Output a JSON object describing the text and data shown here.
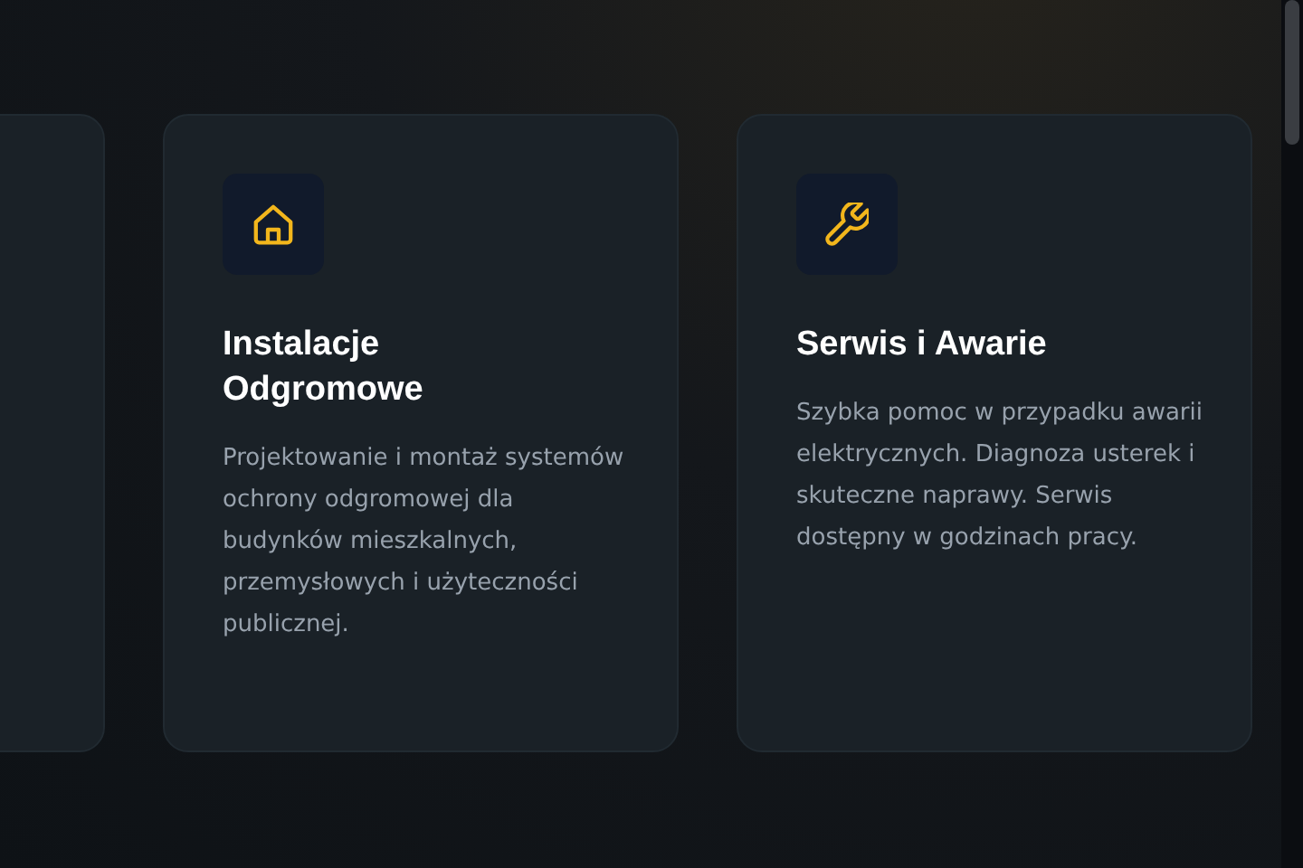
{
  "cards": [
    {
      "title": "Instalacje Odgromowe",
      "text": "Projektowanie i montaż systemów ochrony odgromowej dla budynków mieszkalnych, przemysłowych i użyteczności publicznej."
    },
    {
      "title": "Serwis i Awarie",
      "text": "Szybka pomoc w przypadku awarii elektrycznych. Diagnoza usterek i skuteczne naprawy. Serwis dostępny w godzinach pracy."
    }
  ]
}
